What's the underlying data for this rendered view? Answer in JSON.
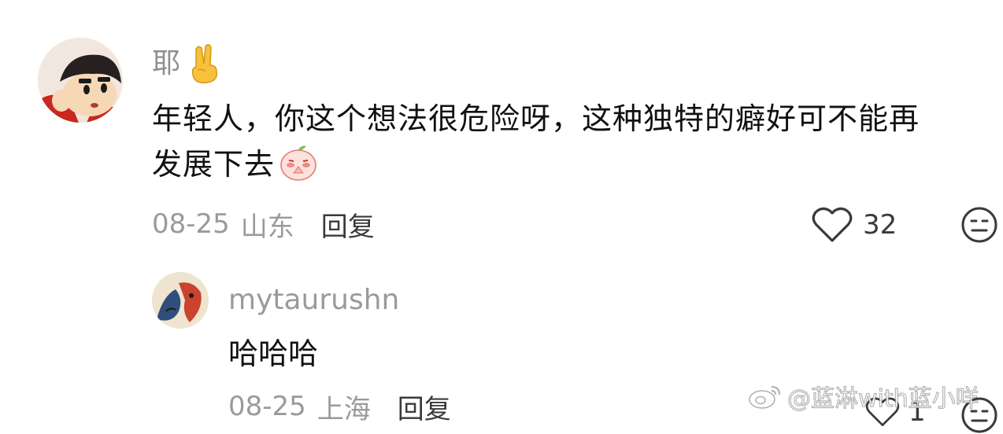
{
  "comment": {
    "username": "耶",
    "username_emoji": "victory-hand",
    "text_lines": [
      "年轻人，你这个想法很危险呀，这种独特的癖好可不能再",
      "发展下去"
    ],
    "sticker": "praying-peach-sticker",
    "date": "08-25",
    "location": "山东",
    "reply_label": "回复",
    "like_count": "32"
  },
  "reply": {
    "username": "mytaurushn",
    "text": "哈哈哈",
    "date": "08-25",
    "location": "上海",
    "reply_label": "回复",
    "like_count": "1"
  },
  "watermark": {
    "text": "@蓝淋with蓝小咩"
  },
  "colors": {
    "background": "#ffffff",
    "username": "#8e8e8e",
    "body_text": "#111111",
    "meta_text": "#9a9a9a",
    "action_text": "#3a3a3a"
  }
}
